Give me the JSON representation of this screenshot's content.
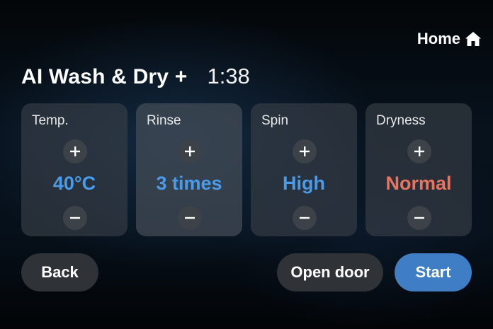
{
  "header": {
    "home_label": "Home",
    "home_icon": "home-icon"
  },
  "program": {
    "title": "AI Wash & Dry +",
    "time_remaining": "1:38"
  },
  "settings": [
    {
      "label": "Temp.",
      "value": "40°C",
      "value_color": "#4a9be8"
    },
    {
      "label": "Rinse",
      "value": "3 times",
      "value_color": "#4a9be8"
    },
    {
      "label": "Spin",
      "value": "High",
      "value_color": "#4a9be8"
    },
    {
      "label": "Dryness",
      "value": "Normal",
      "value_color": "#e8735f"
    }
  ],
  "footer": {
    "back_label": "Back",
    "open_door_label": "Open door",
    "start_label": "Start"
  },
  "colors": {
    "accent": "#3f7ec4",
    "value_blue": "#4a9be8",
    "value_warn": "#e8735f"
  }
}
